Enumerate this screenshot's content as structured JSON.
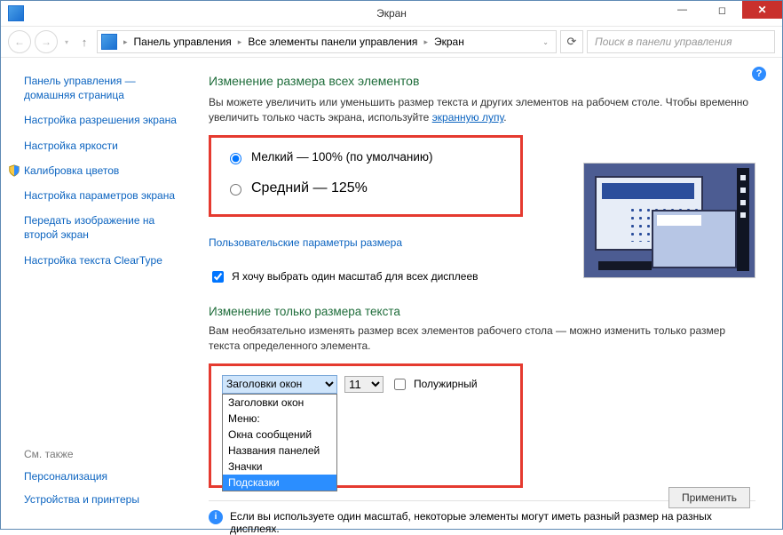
{
  "window": {
    "title": "Экран"
  },
  "nav": {
    "crumb1": "Панель управления",
    "crumb2": "Все элементы панели управления",
    "crumb3": "Экран",
    "search_placeholder": "Поиск в панели управления"
  },
  "sidebar": {
    "items": [
      {
        "label": "Панель управления — домашняя страница"
      },
      {
        "label": "Настройка разрешения экрана"
      },
      {
        "label": "Настройка яркости"
      },
      {
        "label": "Калибровка цветов",
        "shield": true
      },
      {
        "label": "Настройка параметров экрана"
      },
      {
        "label": "Передать изображение на второй экран"
      },
      {
        "label": "Настройка текста ClearType"
      }
    ]
  },
  "see_also": {
    "header": "См. также",
    "items": [
      {
        "label": "Персонализация"
      },
      {
        "label": "Устройства и принтеры"
      }
    ]
  },
  "main": {
    "heading1": "Изменение размера всех элементов",
    "desc1_a": "Вы можете увеличить или уменьшить размер текста и других элементов на рабочем столе. Чтобы временно увеличить только часть экрана, используйте ",
    "magnifier_link": "экранную лупу",
    "desc1_b": ".",
    "radio_small": "Мелкий — 100% (по умолчанию)",
    "radio_medium": "Средний — 125%",
    "custom_size_link": "Пользовательские параметры размера",
    "checkbox_label": "Я хочу выбрать один масштаб для всех дисплеев",
    "heading2": "Изменение только размера текста",
    "desc2": "Вам необязательно изменять размер всех элементов рабочего стола — можно изменить только размер текста определенного элемента.",
    "element_select_value": "Заголовки окон",
    "size_select_value": "11",
    "bold_label": "Полужирный",
    "dropdown_options": [
      "Заголовки окон",
      "Меню:",
      "Окна сообщений",
      "Названия панелей",
      "Значки",
      "Подсказки"
    ],
    "dropdown_selected_index": 5,
    "note_text": "Если вы используете один масштаб, некоторые элементы могут иметь разный размер на разных дисплеях.",
    "apply_button": "Применить"
  }
}
